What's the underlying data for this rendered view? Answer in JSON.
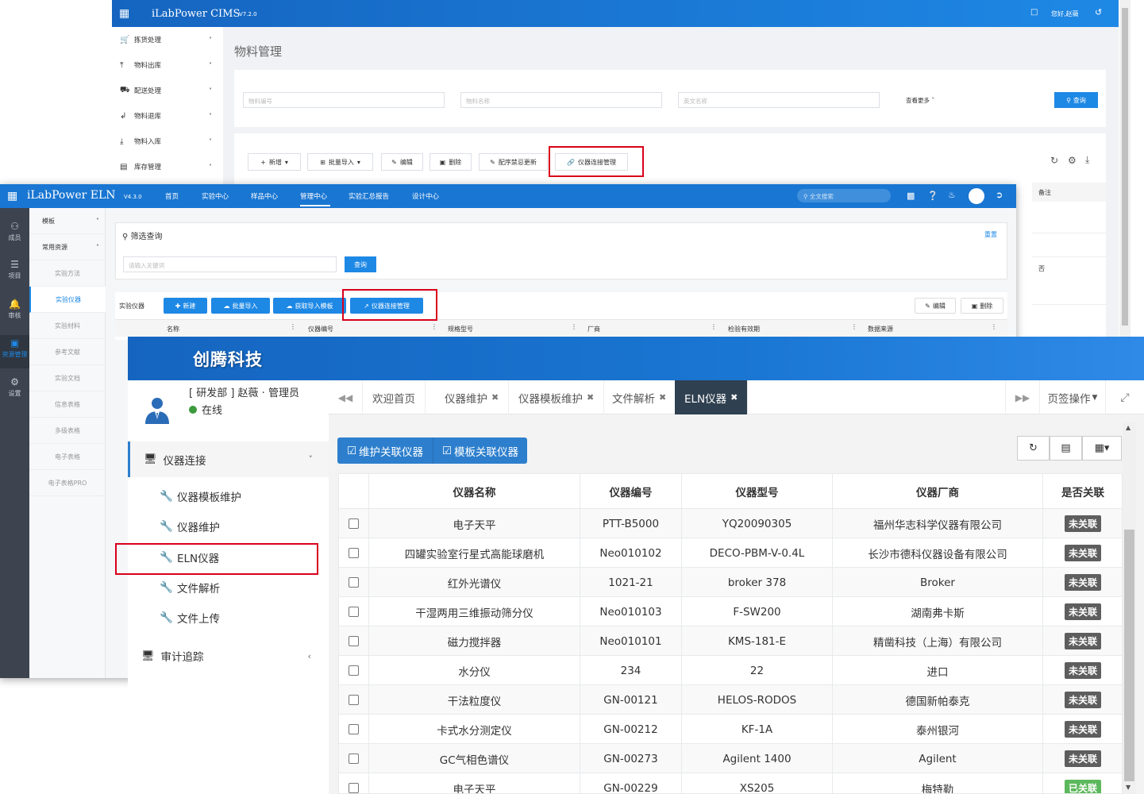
{
  "cims": {
    "title": "iLabPower CIMS",
    "version": "V7.2.0",
    "greeting": "您好,赵薇",
    "page_title": "物料管理",
    "nav": [
      {
        "label": "拣货处理",
        "icon": "cart-icon"
      },
      {
        "label": "物料出库",
        "icon": "upload-icon"
      },
      {
        "label": "配送处理",
        "icon": "truck-icon"
      },
      {
        "label": "物料退库",
        "icon": "return-icon"
      },
      {
        "label": "物料入库",
        "icon": "download-icon"
      },
      {
        "label": "库存管理",
        "icon": "stock-icon"
      }
    ],
    "search": {
      "code_placeholder": "物料编号",
      "name_placeholder": "物料名称",
      "en_placeholder": "英文名称",
      "more": "查看更多",
      "query": "查询"
    },
    "toolbar": {
      "add": "新增",
      "import": "批量导入",
      "edit": "编辑",
      "delete": "删除",
      "update": "配序禁忌更新",
      "instrument_conn": "仪器连接管理"
    },
    "table": {
      "remark_header": "备注",
      "remark_value": "否"
    }
  },
  "eln": {
    "title": "iLabPower ELN",
    "version": "V4.3.0",
    "menu": [
      "首页",
      "实验中心",
      "样品中心",
      "管理中心",
      "实验汇总报告",
      "设计中心"
    ],
    "active_menu": "管理中心",
    "search_placeholder": "全文搜索",
    "rail": [
      {
        "label": "成员",
        "icon": "members-icon"
      },
      {
        "label": "项目",
        "icon": "list-icon"
      },
      {
        "label": "审核",
        "icon": "bell-icon"
      },
      {
        "label": "资源管理",
        "icon": "resource-icon"
      },
      {
        "label": "设置",
        "icon": "settings-icon"
      }
    ],
    "sub_groups": [
      {
        "label": "模板",
        "chevron": "˅"
      },
      {
        "label": "常用资源",
        "chevron": "˄"
      }
    ],
    "sub_items": [
      "实验方法",
      "实验仪器",
      "实验材料",
      "参考文献",
      "实验文档",
      "信息表格",
      "多级表格",
      "电子表格",
      "电子表格PRO"
    ],
    "active_sub": "实验仪器",
    "filter_title": "筛选查询",
    "reset": "重置",
    "keyword_placeholder": "请输入关键词",
    "query": "查询",
    "section_label": "实验仪器",
    "buttons": {
      "new": "新建",
      "import": "批量导入",
      "template": "获取导入模板",
      "conn": "仪器连接管理",
      "edit": "编辑",
      "delete": "删除"
    },
    "columns": [
      "名称",
      "仪器编号",
      "规格型号",
      "厂商",
      "检验有效期",
      "数据来源"
    ]
  },
  "front": {
    "brand": "创腾科技",
    "user": {
      "dept": "[ 研发部 ] 赵薇 · 管理员",
      "status": "在线"
    },
    "menu": {
      "group1": "仪器连接",
      "items": [
        "仪器模板维护",
        "仪器维护",
        "ELN仪器",
        "文件解析",
        "文件上传"
      ],
      "group2": "审计追踪"
    },
    "tabs": [
      {
        "label": "欢迎首页",
        "closable": false
      },
      {
        "label": "仪器维护",
        "closable": true
      },
      {
        "label": "仪器模板维护",
        "closable": true
      },
      {
        "label": "文件解析",
        "closable": true
      },
      {
        "label": "ELN仪器",
        "closable": true
      }
    ],
    "active_tab": "ELN仪器",
    "page_ops": "页签操作",
    "actions": {
      "maintain": "维护关联仪器",
      "template": "模板关联仪器"
    },
    "columns": [
      "仪器名称",
      "仪器编号",
      "仪器型号",
      "仪器厂商",
      "是否关联"
    ],
    "rows": [
      {
        "name": "电子天平",
        "code": "PTT-B5000",
        "model": "YQ20090305",
        "vendor": "福州华志科学仪器有限公司",
        "linked": "未关联"
      },
      {
        "name": "四罐实验室行星式高能球磨机",
        "code": "Neo010102",
        "model": "DECO-PBM-V-0.4L",
        "vendor": "长沙市德科仪器设备有限公司",
        "linked": "未关联"
      },
      {
        "name": "红外光谱仪",
        "code": "1021-21",
        "model": "broker 378",
        "vendor": "Broker",
        "linked": "未关联"
      },
      {
        "name": "干湿两用三维振动筛分仪",
        "code": "Neo010103",
        "model": "F-SW200",
        "vendor": "湖南弗卡斯",
        "linked": "未关联"
      },
      {
        "name": "磁力搅拌器",
        "code": "Neo010101",
        "model": "KMS-181-E",
        "vendor": "精凿科技（上海）有限公司",
        "linked": "未关联"
      },
      {
        "name": "水分仪",
        "code": "234",
        "model": "22",
        "vendor": "进口",
        "linked": "未关联"
      },
      {
        "name": "干法粒度仪",
        "code": "GN-00121",
        "model": "HELOS-RODOS",
        "vendor": "德国新帕泰克",
        "linked": "未关联"
      },
      {
        "name": "卡式水分测定仪",
        "code": "GN-00212",
        "model": "KF-1A",
        "vendor": "泰州银河",
        "linked": "未关联"
      },
      {
        "name": "GC气相色谱仪",
        "code": "GN-00273",
        "model": "Agilent 1400",
        "vendor": "Agilent",
        "linked": "未关联"
      },
      {
        "name": "电子天平",
        "code": "GN-00229",
        "model": "XS205",
        "vendor": "梅特勒",
        "linked": "已关联"
      }
    ]
  }
}
